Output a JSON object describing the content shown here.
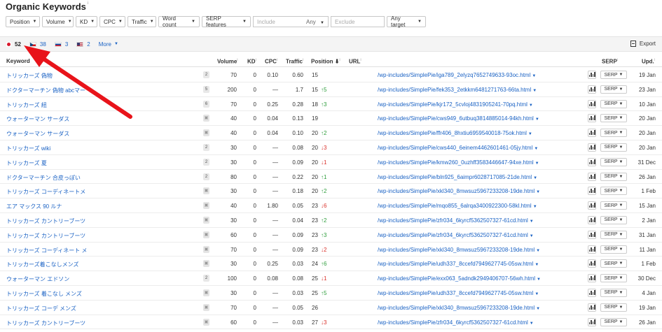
{
  "page": {
    "title": "Organic Keywords",
    "info": "i"
  },
  "filters": {
    "buttons": [
      "Position",
      "Volume",
      "KD",
      "CPC",
      "Traffic",
      "Word count",
      "SERP features"
    ],
    "include_placeholder": "Include",
    "include_any": "Any",
    "exclude_placeholder": "Exclude",
    "target": "Any target"
  },
  "countries": [
    {
      "flag": "jp",
      "count": "52"
    },
    {
      "flag": "cz",
      "count": "38"
    },
    {
      "flag": "sk",
      "count": "3"
    },
    {
      "flag": "us",
      "count": "2"
    }
  ],
  "more_label": "More",
  "export_label": "Export",
  "columns": {
    "keyword": "Keyword",
    "volume": "Volume",
    "kd": "KD",
    "cpc": "CPC",
    "traffic": "Traffic",
    "position": "Position",
    "url": "URL",
    "serp": "SERP",
    "updated": "Upd."
  },
  "serp_label": "SERP",
  "rows": [
    {
      "keyword": "トリッカーズ 偽物",
      "badge": "2",
      "volume": "70",
      "kd": "0",
      "cpc": "0.10",
      "traffic": "0.60",
      "position": "15",
      "change": "",
      "dir": "",
      "url": "/wp-includes/SimplePie/iga789_2elyzq7652749633-93oc.html",
      "updated": "19 Jan"
    },
    {
      "keyword": "ドクターマーチン 偽物 abcマー",
      "badge": "5",
      "volume": "200",
      "kd": "0",
      "cpc": "—",
      "traffic": "1.7",
      "position": "15",
      "change": "5",
      "dir": "up",
      "url": "/wp-includes/SimplePie/fek353_2etkkm6481271763-66ta.html",
      "updated": "23 Jan"
    },
    {
      "keyword": "トリッカーズ 紐",
      "badge": "6",
      "volume": "70",
      "kd": "0",
      "cpc": "0.25",
      "traffic": "0.28",
      "position": "18",
      "change": "3",
      "dir": "up",
      "url": "/wp-includes/SimplePie/kjr172_5cvloj4831905241-70pq.html",
      "updated": "10 Jan"
    },
    {
      "keyword": "ウォーターマン サーダス",
      "badge": "img",
      "volume": "40",
      "kd": "0",
      "cpc": "0.04",
      "traffic": "0.13",
      "position": "19",
      "change": "",
      "dir": "",
      "url": "/wp-includes/SimplePie/cws949_6utbuq3814885014-94kh.html",
      "updated": "20 Jan"
    },
    {
      "keyword": "ウォーターマン サーダス",
      "badge": "img",
      "volume": "40",
      "kd": "0",
      "cpc": "0.04",
      "traffic": "0.10",
      "position": "20",
      "change": "2",
      "dir": "up",
      "url": "/wp-includes/SimplePie/ffr406_8hxtiu6959540018-75ok.html",
      "updated": "20 Jan"
    },
    {
      "keyword": "トリッカーズ wiki",
      "badge": "2",
      "volume": "30",
      "kd": "0",
      "cpc": "—",
      "traffic": "0.08",
      "position": "20",
      "change": "3",
      "dir": "dn",
      "url": "/wp-includes/SimplePie/cws440_6einem4462601461-05jy.html",
      "updated": "20 Jan"
    },
    {
      "keyword": "トリッカーズ 夏",
      "badge": "2",
      "volume": "30",
      "kd": "0",
      "cpc": "—",
      "traffic": "0.09",
      "position": "20",
      "change": "1",
      "dir": "dn",
      "url": "/wp-includes/SimplePie/kmw260_0uzhff3583446647-94xe.html",
      "updated": "31 Dec"
    },
    {
      "keyword": "ドクターマーチン 合皮っぽい",
      "badge": "2",
      "volume": "80",
      "kd": "0",
      "cpc": "—",
      "traffic": "0.22",
      "position": "20",
      "change": "1",
      "dir": "up",
      "url": "/wp-includes/SimplePie/bln925_6aimpr6028717085-21de.html",
      "updated": "26 Jan"
    },
    {
      "keyword": "トリッカーズ コーディネートメンズ",
      "badge": "img",
      "volume": "30",
      "kd": "0",
      "cpc": "—",
      "traffic": "0.18",
      "position": "20",
      "change": "2",
      "dir": "up",
      "url": "/wp-includes/SimplePie/xkl340_8mwsuz5967233208-19de.html",
      "updated": "1 Feb"
    },
    {
      "keyword": "エア マックス 90 ルナ",
      "badge": "img",
      "volume": "40",
      "kd": "0",
      "cpc": "1.80",
      "traffic": "0.05",
      "position": "23",
      "change": "6",
      "dir": "dn",
      "url": "/wp-includes/SimplePie/mqo855_6alrqa3400922300-58kl.html",
      "updated": "15 Jan"
    },
    {
      "keyword": "トリッカーズ カントリーブーツ 着こなし",
      "badge": "img",
      "volume": "30",
      "kd": "0",
      "cpc": "—",
      "traffic": "0.04",
      "position": "23",
      "change": "2",
      "dir": "up",
      "url": "/wp-includes/SimplePie/zfr034_6kyrcf5362507327-61cd.html",
      "updated": "2 Jan"
    },
    {
      "keyword": "トリッカーズ カントリーブーツ 着こなし",
      "badge": "img",
      "volume": "60",
      "kd": "0",
      "cpc": "—",
      "traffic": "0.09",
      "position": "23",
      "change": "3",
      "dir": "up",
      "url": "/wp-includes/SimplePie/zfr034_6kyrcf5362507327-61cd.html",
      "updated": "31 Jan"
    },
    {
      "keyword": "トリッカーズ コーディネート メンズ",
      "badge": "img",
      "volume": "70",
      "kd": "0",
      "cpc": "—",
      "traffic": "0.09",
      "position": "23",
      "change": "2",
      "dir": "dn",
      "url": "/wp-includes/SimplePie/xkl340_8mwsuz5967233208-19de.html",
      "updated": "11 Jan"
    },
    {
      "keyword": "トリッカーズ着こなしメンズ",
      "badge": "img",
      "volume": "30",
      "kd": "0",
      "cpc": "0.25",
      "traffic": "0.03",
      "position": "24",
      "change": "6",
      "dir": "up",
      "url": "/wp-includes/SimplePie/udh337_8ccefd7949627745-05sw.html",
      "updated": "1 Feb"
    },
    {
      "keyword": "ウォーターマン エドソン",
      "badge": "2",
      "volume": "100",
      "kd": "0",
      "cpc": "0.08",
      "traffic": "0.08",
      "position": "25",
      "change": "1",
      "dir": "dn",
      "url": "/wp-includes/SimplePie/exx063_5adndk2949406707-56wh.html",
      "updated": "30 Dec"
    },
    {
      "keyword": "トリッカーズ 着こなし メンズ",
      "badge": "img",
      "volume": "30",
      "kd": "0",
      "cpc": "—",
      "traffic": "0.03",
      "position": "25",
      "change": "5",
      "dir": "up",
      "url": "/wp-includes/SimplePie/udh337_8ccefd7949627745-05sw.html",
      "updated": "4 Jan"
    },
    {
      "keyword": "トリッカーズ コーデ メンズ",
      "badge": "img",
      "volume": "70",
      "kd": "0",
      "cpc": "—",
      "traffic": "0.05",
      "position": "26",
      "change": "",
      "dir": "",
      "url": "/wp-includes/SimplePie/xkl340_8mwsuz5967233208-19de.html",
      "updated": "19 Jan"
    },
    {
      "keyword": "トリッカーズ カントリーブーツ コーデ",
      "badge": "img",
      "volume": "60",
      "kd": "0",
      "cpc": "—",
      "traffic": "0.03",
      "position": "27",
      "change": "3",
      "dir": "dn",
      "url": "/wp-includes/SimplePie/zfr034_6kyrcf5362507327-61cd.html",
      "updated": "26 Jan"
    }
  ],
  "colors": {
    "link": "#1a62c4",
    "up": "#2e9d3c",
    "down": "#d9302a",
    "arrow": "#e8131a"
  }
}
